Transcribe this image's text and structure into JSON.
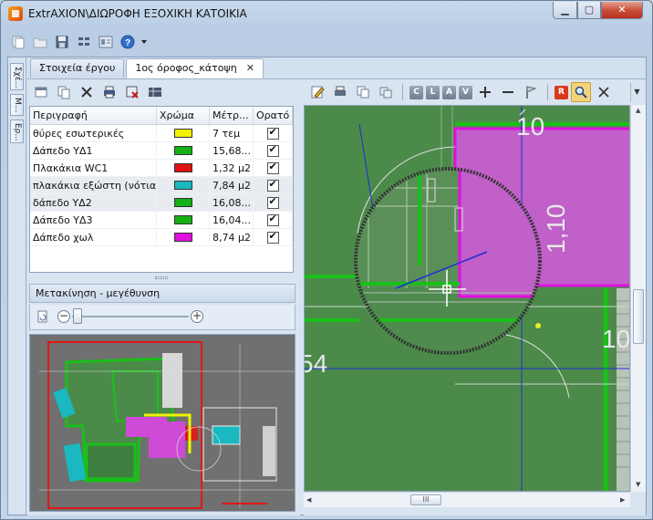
{
  "window": {
    "title": "ExtrAXION\\ΔΙΩΡΟΦΗ ΕΞΟΧΙΚΗ ΚΑΤΟΙΚΙΑ",
    "minimize": "▁",
    "maximize": "▢",
    "close": "✕"
  },
  "toolbar": {
    "icons": [
      "copy-document-icon",
      "open-folder-icon",
      "save-icon",
      "grid-layout-icon",
      "properties-icon",
      "help-icon",
      "dropdown-arrow-icon"
    ]
  },
  "side_tabs": [
    "Σχέ...",
    "Μ...",
    "Ερ..."
  ],
  "doc_tabs": [
    {
      "label": "Στοιχεία έργου",
      "active": false
    },
    {
      "label": "1ος όροφος_κάτοψη",
      "active": true,
      "close": "✕"
    }
  ],
  "layers_panel": {
    "columns": [
      "Περιγραφή",
      "Χρώμα",
      "Μέτρ...",
      "Ορατό"
    ],
    "rows": [
      {
        "description": "θύρες εσωτερικές",
        "color": "#f2f200",
        "measure": "7 τεμ",
        "visible": true
      },
      {
        "description": "Δάπεδο ΥΔ1",
        "color": "#14b014",
        "measure": "15,68...",
        "visible": true
      },
      {
        "description": "Πλακάκια WC1",
        "color": "#e01010",
        "measure": "1,32 μ2",
        "visible": true
      },
      {
        "description": "πλακάκια εξώστη (νότια ...",
        "color": "#1ab8c0",
        "measure": "7,84 μ2",
        "visible": true,
        "selected": true
      },
      {
        "description": "δάπεδο ΥΔ2",
        "color": "#14b014",
        "measure": "16,08...",
        "visible": true,
        "selected": true
      },
      {
        "description": "Δάπεδο ΥΔ3",
        "color": "#14b014",
        "measure": "16,04...",
        "visible": true
      },
      {
        "description": "Δάπεδο χωλ",
        "color": "#e010e0",
        "measure": "8,74 μ2",
        "visible": true
      }
    ]
  },
  "navigation": {
    "title": "Μετακίνηση - μεγέθυνση",
    "zoom_minus": "−",
    "zoom_plus": "+",
    "zoom_level": 0.05
  },
  "drawing": {
    "toolbar_letters": [
      "C",
      "L",
      "A",
      "V"
    ],
    "r_button": "R",
    "dimension_top": "10",
    "dimension_vertical": "1,10",
    "dimension_right": "10",
    "dimension_left": "54",
    "hscroll_grip": "III"
  },
  "colors": {
    "floor_green": "#4c8a4a",
    "wall_green": "#19c019",
    "hall_magenta": "#c060c8",
    "title_bar": "#c9d9ec"
  }
}
